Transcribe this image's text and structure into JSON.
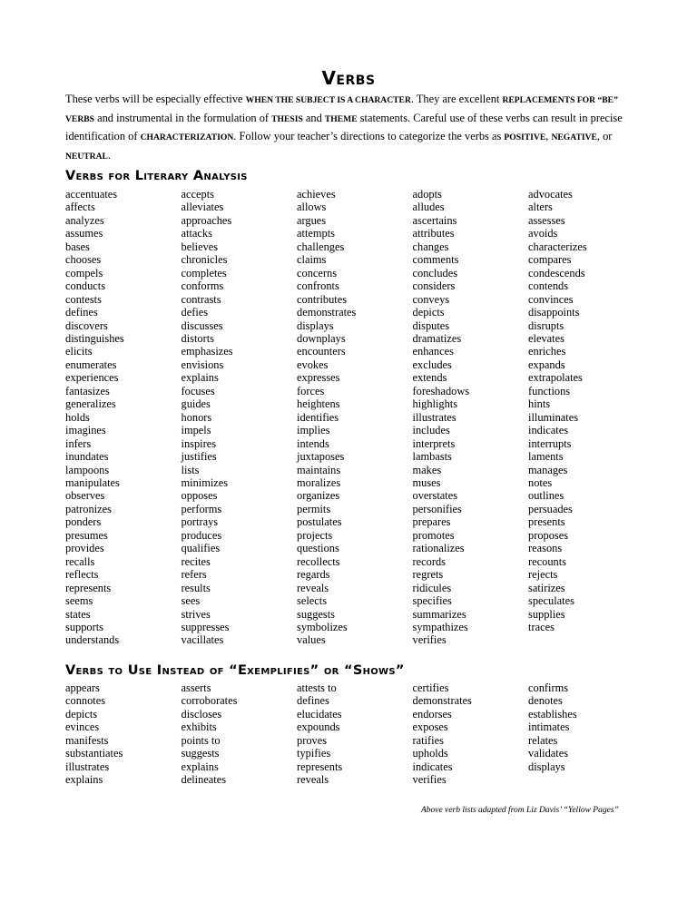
{
  "title": "Verbs",
  "intro": {
    "parts": [
      {
        "t": "These verbs will be especially effective ",
        "b": false
      },
      {
        "t": "WHEN THE SUBJECT IS A CHARACTER",
        "b": true
      },
      {
        "t": ".  They are excellent ",
        "b": false
      },
      {
        "t": "REPLACEMENTS FOR “BE” VERBS",
        "b": true
      },
      {
        "t": " and instrumental in the formulation of ",
        "b": false
      },
      {
        "t": "THESIS",
        "b": true
      },
      {
        "t": " and ",
        "b": false
      },
      {
        "t": "THEME",
        "b": true
      },
      {
        "t": " statements.  Careful use of these verbs can result in precise identification of ",
        "b": false
      },
      {
        "t": "CHARACTERIZATION",
        "b": true
      },
      {
        "t": ".  Follow your teacher’s directions to categorize the verbs as ",
        "b": false
      },
      {
        "t": "POSITIVE",
        "b": true
      },
      {
        "t": ", ",
        "b": false
      },
      {
        "t": "NEGATIVE",
        "b": true
      },
      {
        "t": ", or ",
        "b": false
      },
      {
        "t": "NEUTRAL",
        "b": true
      },
      {
        "t": ".",
        "b": false
      }
    ]
  },
  "sections": [
    {
      "heading": "Verbs for Literary Analysis",
      "columns": [
        [
          "accentuates",
          "affects",
          "analyzes",
          "assumes",
          "bases",
          "chooses",
          "compels",
          "conducts",
          "contests",
          "defines",
          "discovers",
          "distinguishes",
          "elicits",
          "enumerates",
          "experiences",
          "fantasizes",
          "generalizes",
          "holds",
          "imagines",
          "infers",
          "inundates",
          "lampoons",
          "manipulates",
          "observes",
          "patronizes",
          "ponders",
          "presumes",
          "provides",
          "recalls",
          "reflects",
          "represents",
          "seems",
          "states",
          "supports",
          "understands"
        ],
        [
          "accepts",
          "alleviates",
          "approaches",
          "attacks",
          "believes",
          "chronicles",
          "completes",
          "conforms",
          "contrasts",
          "defies",
          "discusses",
          "distorts",
          "emphasizes",
          "envisions",
          "explains",
          "focuses",
          "guides",
          "honors",
          "impels",
          "inspires",
          "justifies",
          "lists",
          "minimizes",
          "opposes",
          "performs",
          "portrays",
          "produces",
          "qualifies",
          "recites",
          "refers",
          "results",
          "sees",
          "strives",
          "suppresses",
          "vacillates"
        ],
        [
          "achieves",
          "allows",
          "argues",
          "attempts",
          "challenges",
          "claims",
          "concerns",
          "confronts",
          "contributes",
          "demonstrates",
          "displays",
          "downplays",
          "encounters",
          "evokes",
          "expresses",
          "forces",
          "heightens",
          "identifies",
          "implies",
          "intends",
          "juxtaposes",
          "maintains",
          "moralizes",
          "organizes",
          "permits",
          "postulates",
          "projects",
          "questions",
          "recollects",
          "regards",
          "reveals",
          "selects",
          "suggests",
          "symbolizes",
          "values"
        ],
        [
          "adopts",
          "alludes",
          "ascertains",
          "attributes",
          "changes",
          "comments",
          "concludes",
          "considers",
          "conveys",
          "depicts",
          "disputes",
          "dramatizes",
          "enhances",
          "excludes",
          "extends",
          "foreshadows",
          "highlights",
          "illustrates",
          "includes",
          "interprets",
          "lambasts",
          "makes",
          "muses",
          "overstates",
          "personifies",
          "prepares",
          "promotes",
          "rationalizes",
          "records",
          "regrets",
          "ridicules",
          "specifies",
          "summarizes",
          "sympathizes",
          "verifies"
        ],
        [
          "advocates",
          "alters",
          "assesses",
          "avoids",
          "characterizes",
          "compares",
          "condescends",
          "contends",
          "convinces",
          "disappoints",
          "disrupts",
          "elevates",
          "enriches",
          "expands",
          "extrapolates",
          "functions",
          "hints",
          "illuminates",
          "indicates",
          "interrupts",
          "laments",
          "manages",
          "notes",
          "outlines",
          "persuades",
          "presents",
          "proposes",
          "reasons",
          "recounts",
          "rejects",
          "satirizes",
          "speculates",
          "supplies",
          "traces"
        ]
      ]
    },
    {
      "heading": "Verbs to Use Instead of “Exemplifies” or “Shows”",
      "columns": [
        [
          "appears",
          "connotes",
          "depicts",
          "evinces",
          "manifests",
          "substantiates",
          "illustrates",
          "explains"
        ],
        [
          "asserts",
          "corroborates",
          "discloses",
          "exhibits",
          "points to",
          "suggests",
          "explains",
          "delineates"
        ],
        [
          "attests to",
          "defines",
          "elucidates",
          "expounds",
          "proves",
          "typifies",
          "represents",
          "reveals"
        ],
        [
          "certifies",
          "demonstrates",
          "endorses",
          "exposes",
          "ratifies",
          "upholds",
          "indicates",
          "verifies"
        ],
        [
          "confirms",
          "denotes",
          "establishes",
          "intimates",
          "relates",
          "validates",
          "displays"
        ]
      ]
    }
  ],
  "footer": "Above verb lists adapted from Liz Davis’ “Yellow Pages”"
}
